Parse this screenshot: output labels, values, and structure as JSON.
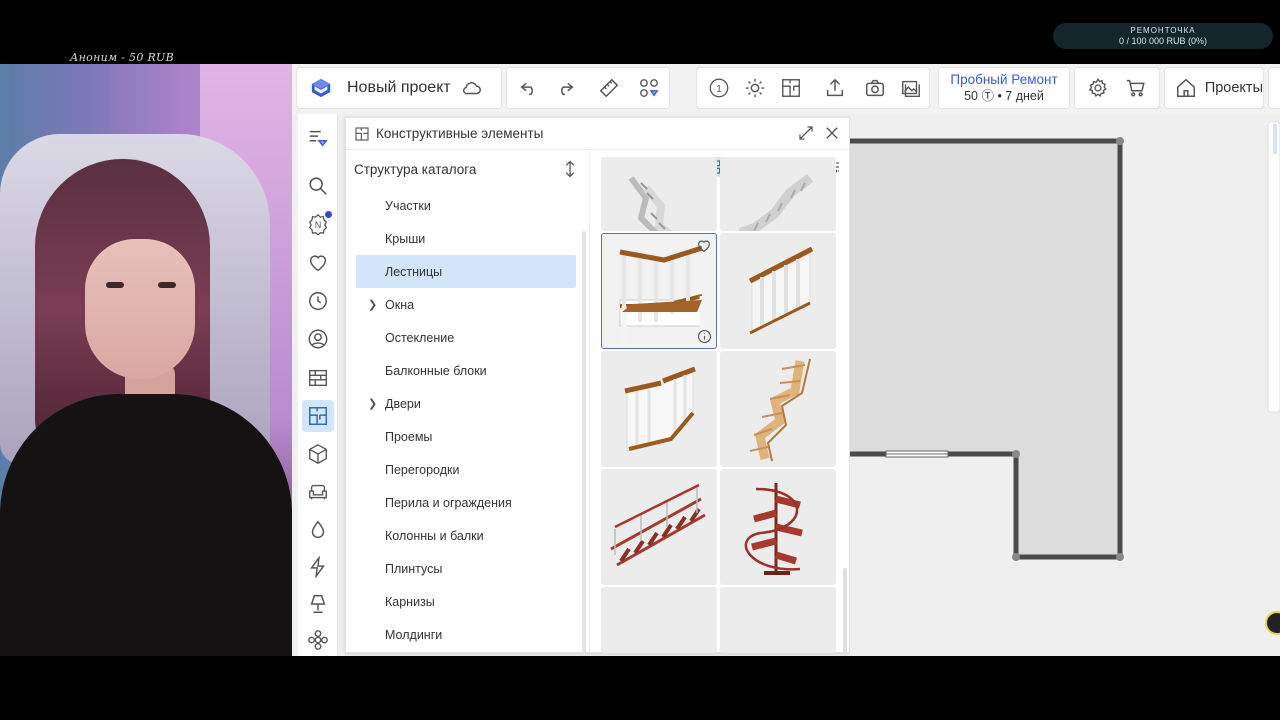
{
  "overlay": {
    "donation": "Аноним - 50 RUB",
    "goal_title": "РЕМОНТОЧКА",
    "goal_progress": "0 / 100 000 RUB (0%)"
  },
  "toolbar": {
    "project_title": "Новый проект",
    "trial_label": "Пробный Ремонт",
    "trial_detail": "50 Ⓣ • 7 дней",
    "projects_label": "Проекты",
    "level_label": "1"
  },
  "panel": {
    "title": "Конструктивные элементы",
    "tree_title": "Структура каталога",
    "items": [
      {
        "label": "Участки",
        "expandable": false,
        "selected": false
      },
      {
        "label": "Крыши",
        "expandable": false,
        "selected": false
      },
      {
        "label": "Лестницы",
        "expandable": false,
        "selected": true
      },
      {
        "label": "Окна",
        "expandable": true,
        "selected": false
      },
      {
        "label": "Остекление",
        "expandable": false,
        "selected": false
      },
      {
        "label": "Балконные блоки",
        "expandable": false,
        "selected": false
      },
      {
        "label": "Двери",
        "expandable": true,
        "selected": false
      },
      {
        "label": "Проемы",
        "expandable": false,
        "selected": false
      },
      {
        "label": "Перегородки",
        "expandable": false,
        "selected": false
      },
      {
        "label": "Перила и ограждения",
        "expandable": false,
        "selected": false
      },
      {
        "label": "Колонны и балки",
        "expandable": false,
        "selected": false
      },
      {
        "label": "Плинтусы",
        "expandable": false,
        "selected": false
      },
      {
        "label": "Карнизы",
        "expandable": false,
        "selected": false
      },
      {
        "label": "Молдинги",
        "expandable": false,
        "selected": false
      }
    ]
  },
  "colors": {
    "accent": "#3a5bd1",
    "selection": "#d3e5fb",
    "wall": "#4a4a4a",
    "room": "#dedede"
  }
}
